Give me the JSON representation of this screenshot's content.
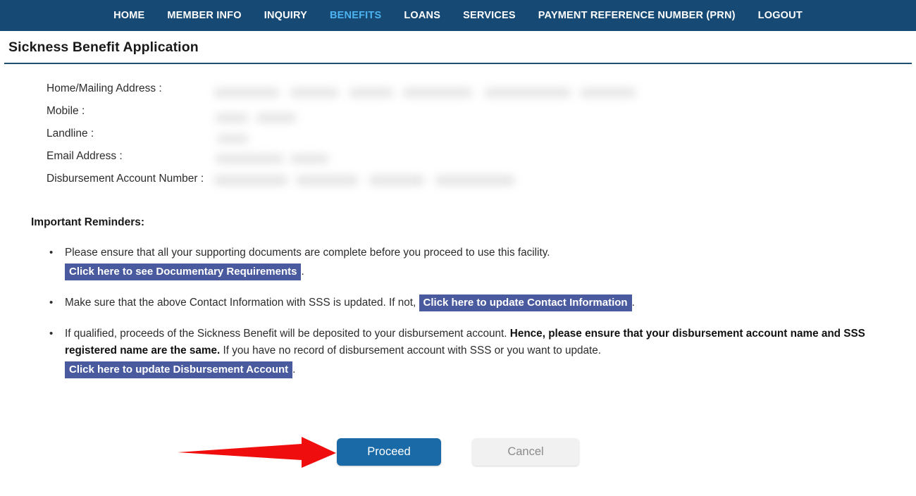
{
  "navbar": {
    "items": [
      {
        "label": "HOME",
        "active": false
      },
      {
        "label": "MEMBER INFO",
        "active": false
      },
      {
        "label": "INQUIRY",
        "active": false
      },
      {
        "label": "BENEFITS",
        "active": true
      },
      {
        "label": "LOANS",
        "active": false
      },
      {
        "label": "SERVICES",
        "active": false
      },
      {
        "label": "PAYMENT REFERENCE NUMBER (PRN)",
        "active": false
      },
      {
        "label": "LOGOUT",
        "active": false
      }
    ],
    "background_color": "#164a75",
    "active_color": "#4db2f0"
  },
  "header": {
    "title": "Sickness Benefit Application",
    "rule_color": "#1d5070"
  },
  "contact_info": {
    "rows": [
      {
        "label": "Home/Mailing Address :",
        "value_redacted": true
      },
      {
        "label": "Mobile :",
        "value_redacted": true
      },
      {
        "label": "Landline :",
        "value_redacted": true
      },
      {
        "label": "Email Address :",
        "value_redacted": true
      },
      {
        "label": "Disbursement Account Number :",
        "value_redacted": true
      }
    ]
  },
  "reminders": {
    "heading": "Important Reminders:",
    "items": [
      {
        "text_before": "Please ensure that all your supporting documents are complete before you proceed to use this facility.",
        "link_label": "Click here to see Documentary Requirements",
        "link_on_new_line": true,
        "text_after": ".",
        "bold_text": "",
        "text_tail": ""
      },
      {
        "text_before": "Make sure that the above Contact Information with SSS is updated. If not,",
        "link_label": "Click here to update Contact Information",
        "link_on_new_line": false,
        "text_after": ".",
        "bold_text": "",
        "text_tail": ""
      },
      {
        "text_before": "If qualified, proceeds of the Sickness Benefit will be deposited to your disbursement account.",
        "bold_text": "Hence, please ensure that your disbursement account name and SSS registered name are the same.",
        "text_tail": "If you have no record of disbursement account with SSS or you want to update.",
        "link_label": "Click here to update Disbursement Account",
        "link_on_new_line": true,
        "text_after": "."
      }
    ],
    "link_background_color": "#4a5a9e"
  },
  "actions": {
    "proceed_label": "Proceed",
    "cancel_label": "Cancel",
    "proceed_color": "#1a6aa8",
    "cancel_color": "#f1f1f1"
  },
  "annotation": {
    "arrow_color": "#f00d0d",
    "points_to": "Proceed"
  }
}
